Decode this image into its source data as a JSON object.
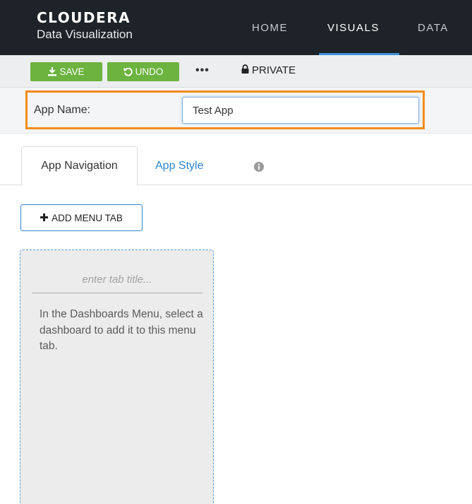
{
  "header": {
    "brand_name": "CLOUDERA",
    "brand_sub": "Data Visualization",
    "nav": [
      {
        "label": "HOME",
        "active": false
      },
      {
        "label": "VISUALS",
        "active": true
      },
      {
        "label": "DATA",
        "active": false
      }
    ]
  },
  "toolbar": {
    "save_label": "SAVE",
    "undo_label": "UNDO",
    "more_label": "•••",
    "private_label": "PRIVATE"
  },
  "app_name": {
    "label": "App Name:",
    "value": "Test App"
  },
  "tabs": [
    {
      "label": "App Navigation",
      "active": true
    },
    {
      "label": "App Style",
      "active": false
    }
  ],
  "add_menu_tab_label": "ADD MENU TAB",
  "menu_card": {
    "title_placeholder": "enter tab title...",
    "help_text": "In the Dashboards Menu, select a dashboard to add it to this menu tab."
  },
  "colors": {
    "topbar": "#1d2328",
    "accent_blue": "#2f86d0",
    "button_green": "#6cb33f",
    "highlight_orange": "#f28c1c"
  }
}
